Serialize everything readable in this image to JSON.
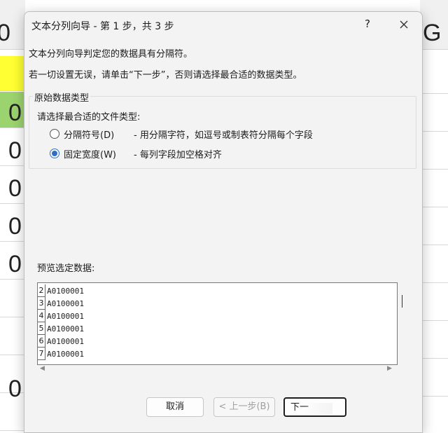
{
  "background_sheet": {
    "left_column_values": [
      "0",
      "0",
      "0",
      "0",
      "0",
      "0",
      "0"
    ],
    "right_header_letter": "G",
    "highlight_colors": {
      "yellow": "#ffff33",
      "green": "#9bd36e"
    }
  },
  "dialog": {
    "title": "文本分列向导 - 第 1 步，共 3 步",
    "help_label": "?",
    "close_icon": "close-icon",
    "message_1": "文本分列向导判定您的数据具有分隔符。",
    "message_2": "若一切设置无误，请单击“下一步”，否则请选择最合适的数据类型。",
    "group_label": "原始数据类型",
    "prompt": "请选择最合适的文件类型:",
    "options": [
      {
        "label": "分隔符号(D)",
        "description": "- 用分隔字符，如逗号或制表符分隔每个字段",
        "selected": false
      },
      {
        "label": "固定宽度(W)",
        "description": "- 每列字段加空格对齐",
        "selected": true
      }
    ],
    "preview_label": "预览选定数据:",
    "preview_rows": [
      {
        "num": "2",
        "value": "A0100001"
      },
      {
        "num": "3",
        "value": "A0100001"
      },
      {
        "num": "4",
        "value": "A0100001"
      },
      {
        "num": "5",
        "value": "A0100001"
      },
      {
        "num": "6",
        "value": "A0100001"
      },
      {
        "num": "7",
        "value": "A0100001"
      }
    ],
    "buttons": {
      "cancel": "取消",
      "prev": "< 上一步(B)",
      "next": "下一"
    },
    "accent_color": "#2f6fc0"
  }
}
